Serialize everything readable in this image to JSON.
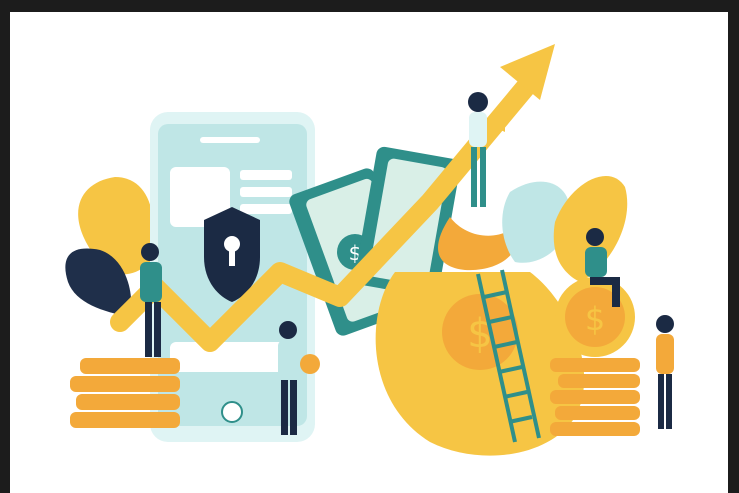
{
  "image": {
    "kind": "illustration",
    "colors": {
      "frame": "#1c1c1c",
      "background": "#ffffff",
      "teal": "#2f8f8a",
      "light_teal": "#bfe6e6",
      "yellow": "#f6c544",
      "orange": "#f3a93a",
      "navy": "#1f2f4a",
      "dark_navy": "#1b2a44",
      "money_green": "#d9efe7"
    },
    "icons": [
      "smartphone-icon",
      "shield-lock-icon",
      "upward-arrow-icon",
      "dollar-coin-icon",
      "money-bag-icon",
      "banknote-icon",
      "ladder-icon",
      "leaf-icon",
      "person-icon"
    ]
  }
}
